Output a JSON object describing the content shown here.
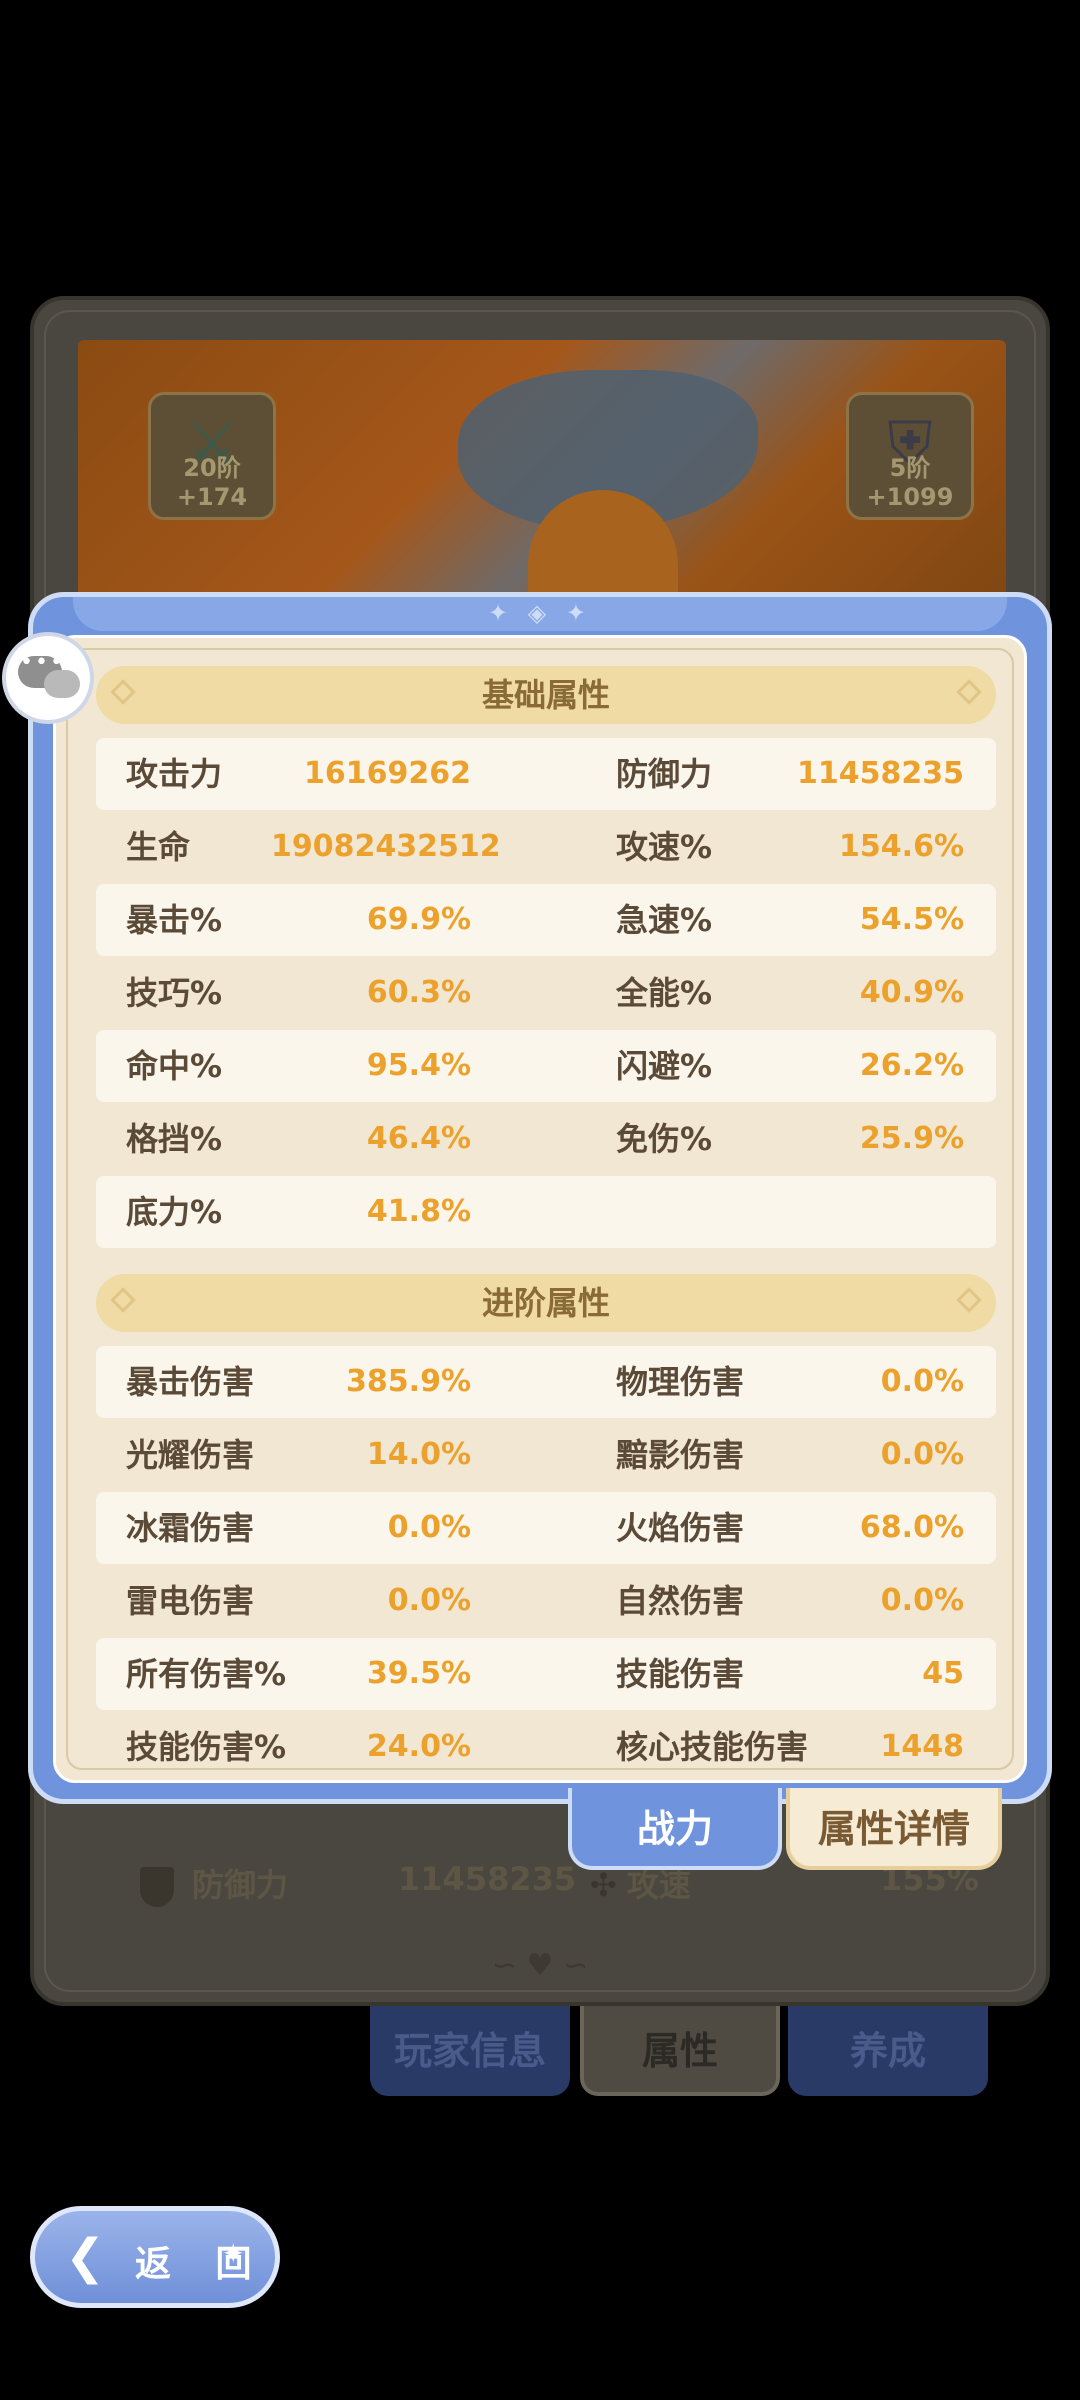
{
  "background": {
    "equip_left_label": "20阶+174",
    "equip_right_label": "5阶+1099",
    "hidden_stat_1_name": "生命值",
    "hidden_stat_1_value": "19082432512",
    "stat_defense_name": "防御力",
    "stat_defense_value": "11458235",
    "stat_speed_name": "攻速",
    "stat_speed_value": "155%"
  },
  "bottom_tabs": [
    "玩家信息",
    "属性",
    "养成"
  ],
  "back_button": "返 回",
  "panel": {
    "basic_title": "基础属性",
    "advanced_title": "进阶属性",
    "basic_stats": [
      {
        "n1": "攻击力",
        "v1": "16169262",
        "n2": "防御力",
        "v2": "11458235"
      },
      {
        "n1": "生命",
        "v1": "19082432512",
        "n2": "攻速%",
        "v2": "154.6%"
      },
      {
        "n1": "暴击%",
        "v1": "69.9%",
        "n2": "急速%",
        "v2": "54.5%"
      },
      {
        "n1": "技巧%",
        "v1": "60.3%",
        "n2": "全能%",
        "v2": "40.9%"
      },
      {
        "n1": "命中%",
        "v1": "95.4%",
        "n2": "闪避%",
        "v2": "26.2%"
      },
      {
        "n1": "格挡%",
        "v1": "46.4%",
        "n2": "免伤%",
        "v2": "25.9%"
      },
      {
        "n1": "底力%",
        "v1": "41.8%",
        "n2": "",
        "v2": ""
      }
    ],
    "advanced_stats": [
      {
        "n1": "暴击伤害",
        "v1": "385.9%",
        "n2": "物理伤害",
        "v2": "0.0%"
      },
      {
        "n1": "光耀伤害",
        "v1": "14.0%",
        "n2": "黯影伤害",
        "v2": "0.0%"
      },
      {
        "n1": "冰霜伤害",
        "v1": "0.0%",
        "n2": "火焰伤害",
        "v2": "68.0%"
      },
      {
        "n1": "雷电伤害",
        "v1": "0.0%",
        "n2": "自然伤害",
        "v2": "0.0%"
      },
      {
        "n1": "所有伤害%",
        "v1": "39.5%",
        "n2": "技能伤害",
        "v2": "45"
      },
      {
        "n1": "技能伤害%",
        "v1": "24.0%",
        "n2": "核心技能伤害",
        "v2": "1448"
      }
    ]
  },
  "side_tabs": {
    "power": "战力",
    "detail": "属性详情"
  },
  "colors": {
    "panel_blue": "#6f93dc",
    "paper": "#f1e7d2",
    "value_orange": "#eba12c",
    "label_brown": "#5b4a37"
  }
}
